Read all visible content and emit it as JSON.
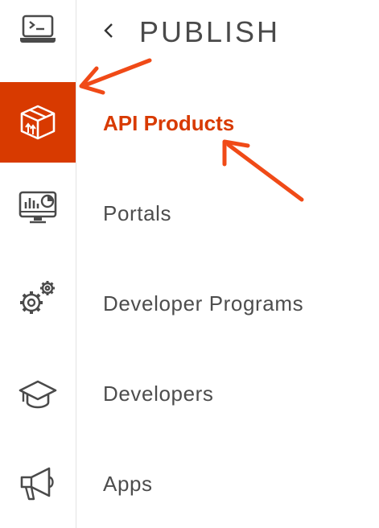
{
  "colors": {
    "accent": "#d83a00",
    "text": "#4d4d4d",
    "rail_icon": "#4a4a4a",
    "active_icon": "#ffffff",
    "annotation_arrow": "#f04a17"
  },
  "header": {
    "back_icon": "chevron-left",
    "title": "PUBLISH"
  },
  "rail": {
    "items": [
      {
        "id": "develop",
        "icon": "terminal-laptop",
        "active": false
      },
      {
        "id": "publish",
        "icon": "box-package",
        "active": true
      },
      {
        "id": "analyze",
        "icon": "monitor-chart",
        "active": false
      },
      {
        "id": "admin",
        "icon": "gears",
        "active": false
      },
      {
        "id": "learn",
        "icon": "graduation-cap",
        "active": false
      },
      {
        "id": "announce",
        "icon": "megaphone",
        "active": false
      }
    ]
  },
  "nav": {
    "items": [
      {
        "label": "API Products",
        "active": true
      },
      {
        "label": "Portals",
        "active": false
      },
      {
        "label": "Developer Programs",
        "active": false
      },
      {
        "label": "Developers",
        "active": false
      },
      {
        "label": "Apps",
        "active": false
      }
    ]
  }
}
